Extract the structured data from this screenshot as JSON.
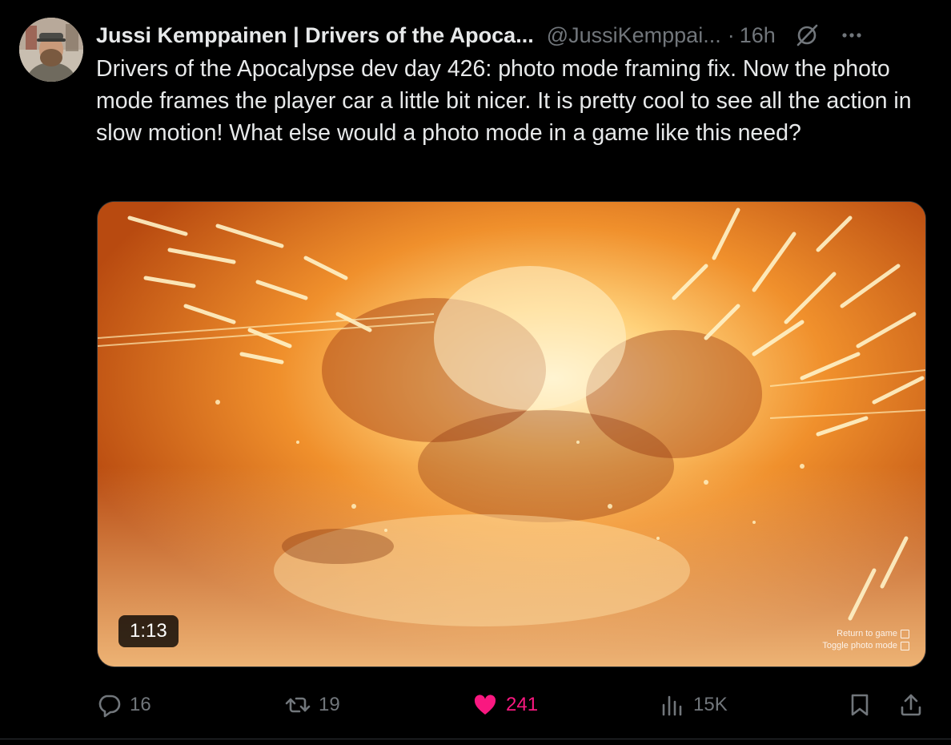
{
  "author": {
    "name": "Jussi Kemppainen | Drivers of the Apoca...",
    "handle": "@JussiKemppai...",
    "separator": "·",
    "time": "16h"
  },
  "icons": {
    "grok": "grok-icon",
    "more": "more-icon",
    "reply": "reply-icon",
    "retweet": "retweet-icon",
    "like": "heart-icon",
    "views": "views-icon",
    "bookmark": "bookmark-icon",
    "share": "share-icon"
  },
  "tweet": {
    "text": "Drivers of the Apocalypse dev day 426: photo mode framing fix. Now the photo mode frames the player car a little bit nicer. It is pretty cool to see all the action in slow motion! What else would a photo mode in a game like this need?"
  },
  "media": {
    "duration": "1:13",
    "hud": {
      "return_label": "Return to game",
      "toggle_label": "Toggle photo mode"
    }
  },
  "stats": {
    "replies": "16",
    "retweets": "19",
    "likes": "241",
    "views": "15K"
  },
  "colors": {
    "background": "#000000",
    "text": "#e7e9ea",
    "muted": "#71767b",
    "like": "#f91880",
    "border": "#2f3336"
  }
}
